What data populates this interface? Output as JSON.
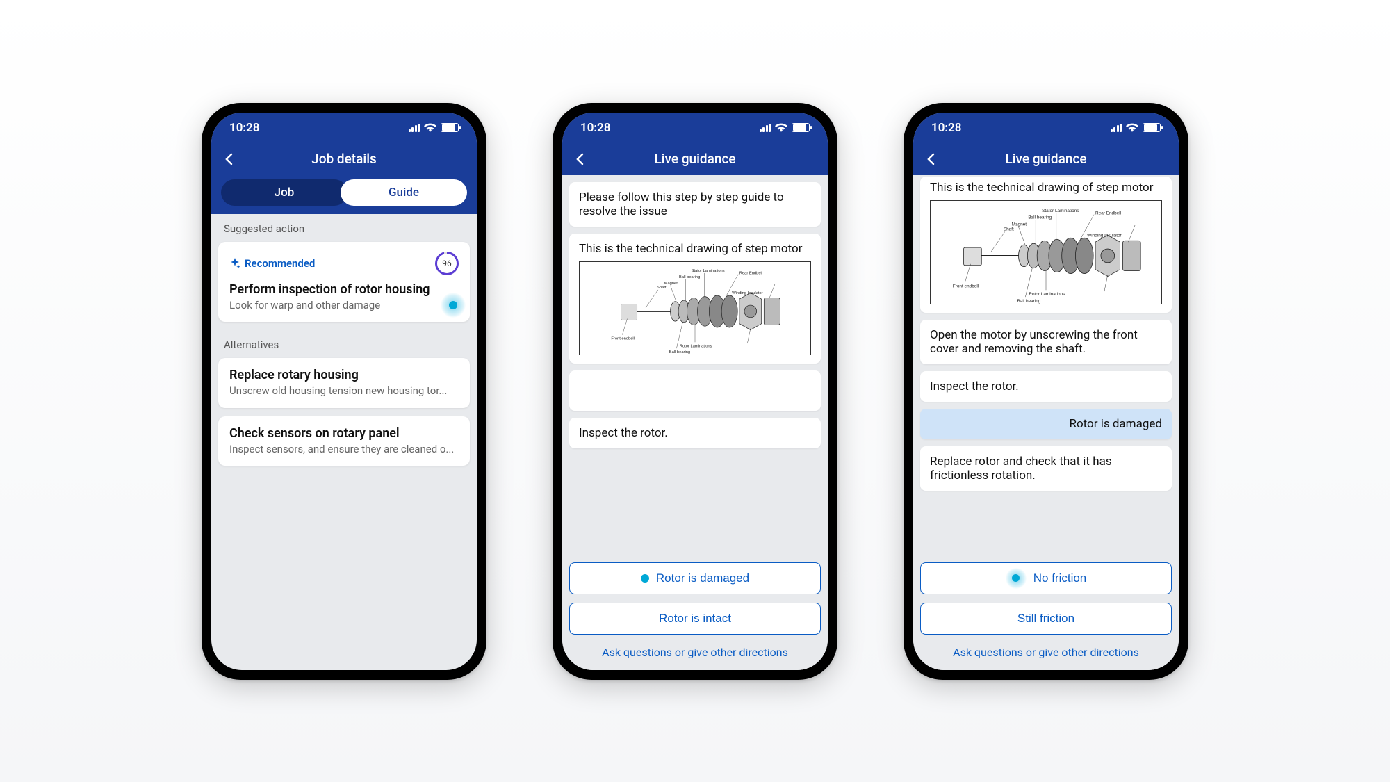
{
  "statusbar": {
    "time": "10:28"
  },
  "phone1": {
    "header_title": "Job details",
    "tab_job": "Job",
    "tab_guide": "Guide",
    "section_suggested": "Suggested action",
    "recommended_label": "Recommended",
    "score": "96",
    "rec_title": "Perform inspection of rotor housing",
    "rec_sub": "Look for warp and other damage",
    "section_alternatives": "Alternatives",
    "alt1_title": "Replace rotary housing",
    "alt1_sub": "Unscrew old housing tension new housing tor...",
    "alt2_title": "Check sensors on rotary panel",
    "alt2_sub": "Inspect sensors, and ensure they are cleaned o..."
  },
  "phone2": {
    "header_title": "Live guidance",
    "msg_intro": "Please follow this step by step guide to resolve the issue",
    "msg_drawing": "This is the technical drawing of step motor",
    "msg_inspect": "Inspect the rotor.",
    "btn_damaged": "Rotor is damaged",
    "btn_intact": "Rotor is intact",
    "ask": "Ask questions or give other directions"
  },
  "phone3": {
    "header_title": "Live guidance",
    "msg_drawing": "This is the technical drawing of step motor",
    "msg_open": "Open the motor by unscrewing the front cover and removing the shaft.",
    "msg_inspect": "Inspect the rotor.",
    "msg_user": "Rotor is damaged",
    "msg_replace": "Replace rotor and check that it has frictionless rotation.",
    "btn_nofric": "No friction",
    "btn_stillfric": "Still friction",
    "ask": "Ask questions or give other directions"
  },
  "drawing_labels": {
    "shaft": "Shaft",
    "magnet": "Magnet",
    "ball": "Ball bearing",
    "front": "Front endbell",
    "stator": "Stator Laminations",
    "rear": "Rear Endbell",
    "winding": "Winding Insulator",
    "rotor": "Rotor Laminations",
    "ball2": "Ball bearing"
  }
}
